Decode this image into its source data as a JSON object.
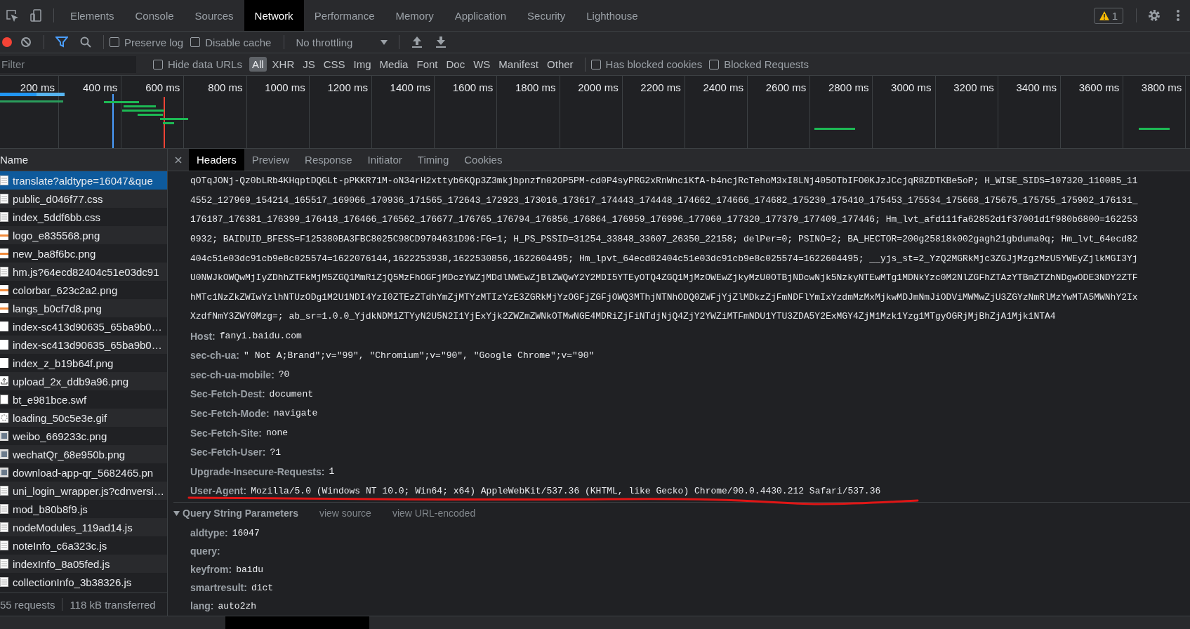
{
  "tabs": [
    {
      "label": "Elements",
      "selected": false
    },
    {
      "label": "Console",
      "selected": false
    },
    {
      "label": "Sources",
      "selected": false
    },
    {
      "label": "Network",
      "selected": true
    },
    {
      "label": "Performance",
      "selected": false
    },
    {
      "label": "Memory",
      "selected": false
    },
    {
      "label": "Application",
      "selected": false
    },
    {
      "label": "Security",
      "selected": false
    },
    {
      "label": "Lighthouse",
      "selected": false
    }
  ],
  "warnings": {
    "count": "1"
  },
  "toolbar": {
    "recording": true,
    "filter_active": true,
    "checkboxes": [
      {
        "label": "Preserve log",
        "checked": false
      },
      {
        "label": "Disable cache",
        "checked": false
      }
    ],
    "throttling": "No throttling"
  },
  "filter_bar": {
    "placeholder": "Filter",
    "hide_data_urls": {
      "label": "Hide data URLs",
      "checked": false
    },
    "types": [
      {
        "label": "All",
        "selected": true
      },
      {
        "label": "XHR",
        "selected": false
      },
      {
        "label": "JS",
        "selected": false
      },
      {
        "label": "CSS",
        "selected": false
      },
      {
        "label": "Img",
        "selected": false
      },
      {
        "label": "Media",
        "selected": false
      },
      {
        "label": "Font",
        "selected": false
      },
      {
        "label": "Doc",
        "selected": false
      },
      {
        "label": "WS",
        "selected": false
      },
      {
        "label": "Manifest",
        "selected": false
      },
      {
        "label": "Other",
        "selected": false
      }
    ],
    "extra_checkboxes": [
      {
        "label": "Has blocked cookies",
        "checked": false
      },
      {
        "label": "Blocked Requests",
        "checked": false
      }
    ]
  },
  "timeline": {
    "ticks": [
      "200 ms",
      "400 ms",
      "600 ms",
      "800 ms",
      "1000 ms",
      "1200 ms",
      "1400 ms",
      "1600 ms",
      "1800 ms",
      "2000 ms",
      "2200 ms",
      "2400 ms",
      "2600 ms",
      "2800 ms",
      "3000 ms",
      "3200 ms",
      "3400 ms",
      "3600 ms",
      "3800 ms"
    ]
  },
  "requests": {
    "column": "Name",
    "items": [
      {
        "name": "translate?aldtype=16047&que",
        "kind": "document",
        "selected": true
      },
      {
        "name": "public_d046f77.css",
        "kind": "document",
        "selected": false
      },
      {
        "name": "index_5ddf6bb.css",
        "kind": "document",
        "selected": false
      },
      {
        "name": "logo_e835568.png",
        "kind": "image",
        "selected": false
      },
      {
        "name": "new_ba8f6bc.png",
        "kind": "image",
        "selected": false
      },
      {
        "name": "hm.js?64ecd82404c51e03dc91",
        "kind": "document",
        "selected": false
      },
      {
        "name": "colorbar_623c2a2.png",
        "kind": "image",
        "selected": false
      },
      {
        "name": "langs_b0cf7d8.png",
        "kind": "image",
        "selected": false
      },
      {
        "name": "index-sc413d90635_65ba9b0…",
        "kind": "blank",
        "selected": false
      },
      {
        "name": "index-sc413d90635_65ba9b0…",
        "kind": "blank",
        "selected": false
      },
      {
        "name": "index_z_b19b64f.png",
        "kind": "blank",
        "selected": false
      },
      {
        "name": "upload_2x_ddb9a96.png",
        "kind": "upload",
        "selected": false
      },
      {
        "name": "bt_e981bce.swf",
        "kind": "plugin",
        "selected": false
      },
      {
        "name": "loading_50c5e3e.gif",
        "kind": "spinner",
        "selected": false
      },
      {
        "name": "weibo_669233c.png",
        "kind": "thumbnail",
        "selected": false
      },
      {
        "name": "wechatQr_68e950b.png",
        "kind": "thumbnail",
        "selected": false
      },
      {
        "name": "download-app-qr_5682465.pn",
        "kind": "thumbnail",
        "selected": false
      },
      {
        "name": "uni_login_wrapper.js?cdnversi…",
        "kind": "document",
        "selected": false
      },
      {
        "name": "mod_b80b8f9.js",
        "kind": "document",
        "selected": false
      },
      {
        "name": "nodeModules_119ad14.js",
        "kind": "document",
        "selected": false
      },
      {
        "name": "noteInfo_c6a323c.js",
        "kind": "document",
        "selected": false
      },
      {
        "name": "indexInfo_8a05fed.js",
        "kind": "document",
        "selected": false
      },
      {
        "name": "collectionInfo_3b38326.js",
        "kind": "document",
        "selected": false
      }
    ]
  },
  "status_bar": {
    "requests": "55 requests",
    "transferred": "118 kB transferred"
  },
  "detail": {
    "tabs": [
      {
        "label": "Headers",
        "selected": true
      },
      {
        "label": "Preview",
        "selected": false
      },
      {
        "label": "Response",
        "selected": false
      },
      {
        "label": "Initiator",
        "selected": false
      },
      {
        "label": "Timing",
        "selected": false
      },
      {
        "label": "Cookies",
        "selected": false
      }
    ],
    "cookie_lines": [
      "qOTqJONj-Qz0bLRb4KHqptDQGLt-pPKKR71M-oN34rH2xttyb6KQp3Z3mkjbpnzfn02OP5PM-cd0P4syPRG2xRnWnciKfA-b4ncjRcTehoM3xI8LNj405OTbIFO0KJzJCcjqR8ZDTKBe5oP; H_WISE_SIDS=107320_110085_11",
      "4552_127969_154214_165517_169066_170936_171565_172643_172923_173016_173617_174443_174448_174662_174666_174682_175230_175410_175453_175534_175668_175675_175755_175902_176131_",
      "176187_176381_176399_176418_176466_176562_176677_176765_176794_176856_176864_176959_176996_177060_177320_177379_177409_177446; Hm_lvt_afd111fa62852d1f37001d1f980b6800=162253",
      "0932; BAIDUID_BFESS=F125380BA3FBC8025C98CD9704631D96:FG=1; H_PS_PSSID=31254_33848_33607_26350_22158; delPer=0; PSINO=2; BA_HECTOR=200g25818k002gagh21gbduma0q; Hm_lvt_64ecd82",
      "404c51e03dc91cb9e8c025574=1622076144,1622253938,1622530856,1622604495; Hm_lpvt_64ecd82404c51e03dc91cb9e8c025574=1622604495; __yjs_st=2_YzQ2MGRkMjc3ZGJjMzgzMzU5YWEyZjlkMGI3Yj",
      "U0NWJkOWQwMjIyZDhhZTFkMjM5ZGQ1MmRiZjQ5MzFhOGFjMDczYWZjMDdlNWEwZjBlZWQwY2Y2MDI5YTEyOTQ4ZGQ1MjMzOWEwZjkyMzU0OTBjNDcwNjk5NzkyNTEwMTg1MDNkYzc0M2NlZGFhZTAzYTBmZTZhNDgwODE3NDY2ZTF",
      "hMTc1NzZkZWIwYzlhNTUzODg1M2U1NDI4YzI0ZTEzZTdhYmZjMTYzMTIzYzE3ZGRkMjYzOGFjZGFjOWQ3MThjNTNhODQ0ZWFjYjZlMDkzZjFmNDFlYmIxYzdmMzMxMjkwMDJmNmJiODViMWMwZjU3ZGYzNmRlMzYwMTA5MWNhY2Ix",
      "XzdfNmY3ZWY0Mzg=; ab_sr=1.0.0_YjdkNDM1ZTYyN2U5N2I1YjExYjk2ZWZmZWNkOTMwNGE4MDRiZjFiNTdjNjQ4ZjY2YWZiMTFmNDU1YTU3ZDA5Y2ExMGY4ZjM1Mzk1Yzg1MTgyOGRjMjBhZjA1Mjk1NTA4"
    ],
    "headers": [
      {
        "name": "Host:",
        "value": "fanyi.baidu.com",
        "underlined": false
      },
      {
        "name": "sec-ch-ua:",
        "value": "\" Not A;Brand\";v=\"99\", \"Chromium\";v=\"90\", \"Google Chrome\";v=\"90\"",
        "underlined": false
      },
      {
        "name": "sec-ch-ua-mobile:",
        "value": "?0",
        "underlined": false
      },
      {
        "name": "Sec-Fetch-Dest:",
        "value": "document",
        "underlined": false
      },
      {
        "name": "Sec-Fetch-Mode:",
        "value": "navigate",
        "underlined": false
      },
      {
        "name": "Sec-Fetch-Site:",
        "value": "none",
        "underlined": false
      },
      {
        "name": "Sec-Fetch-User:",
        "value": "?1",
        "underlined": false
      },
      {
        "name": "Upgrade-Insecure-Requests:",
        "value": "1",
        "underlined": false
      },
      {
        "name": "User-Agent:",
        "value": "Mozilla/5.0 (Windows NT 10.0; Win64; x64) AppleWebKit/537.36 (KHTML, like Gecko) Chrome/90.0.4430.212 Safari/537.36",
        "underlined": true
      }
    ],
    "query": {
      "title": "Query String Parameters",
      "expanded": true,
      "links": [
        "view source",
        "view URL-encoded"
      ],
      "params": [
        {
          "name": "aldtype:",
          "value": "16047"
        },
        {
          "name": "query:"
        },
        {
          "name": "keyfrom:",
          "value": "baidu"
        },
        {
          "name": "smartresult:",
          "value": "dict"
        },
        {
          "name": "lang:",
          "value": "auto2zh"
        }
      ]
    }
  }
}
